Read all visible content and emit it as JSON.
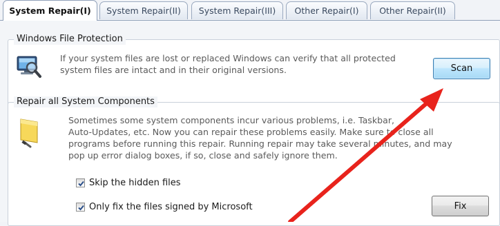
{
  "tabs": [
    {
      "label": "System Repair(I)",
      "active": true
    },
    {
      "label": "System Repair(II)",
      "active": false
    },
    {
      "label": "System Repair(III)",
      "active": false
    },
    {
      "label": "Other Repair(I)",
      "active": false
    },
    {
      "label": "Other Repair(II)",
      "active": false
    }
  ],
  "file_protection": {
    "title": "Windows File Protection",
    "description": "If your system files are lost or replaced Windows can verify that all protected\nsystem files are intact and in their original versions.",
    "scan_label": "Scan",
    "icon": "magnifier-monitor-icon"
  },
  "components": {
    "title": "Repair all System Components",
    "description": "Sometimes some system components incur various problems, i.e. Taskbar,\nAuto-Updates, etc.  Now you can repair these problems easily. Make sure to close all\nprograms before running this repair. Running repair may take several minutes, and may\npop up error dialog boxes, if so, close and safely ignore them.",
    "icon": "folder-tool-icon",
    "skip_hidden": {
      "label": "Skip the hidden files",
      "checked": true
    },
    "signed_only": {
      "label": "Only fix the files signed by Microsoft",
      "checked": true
    },
    "fix_label": "Fix"
  },
  "colors": {
    "accent_arrow": "#e8231c",
    "tab_border": "#8fa0b8"
  }
}
